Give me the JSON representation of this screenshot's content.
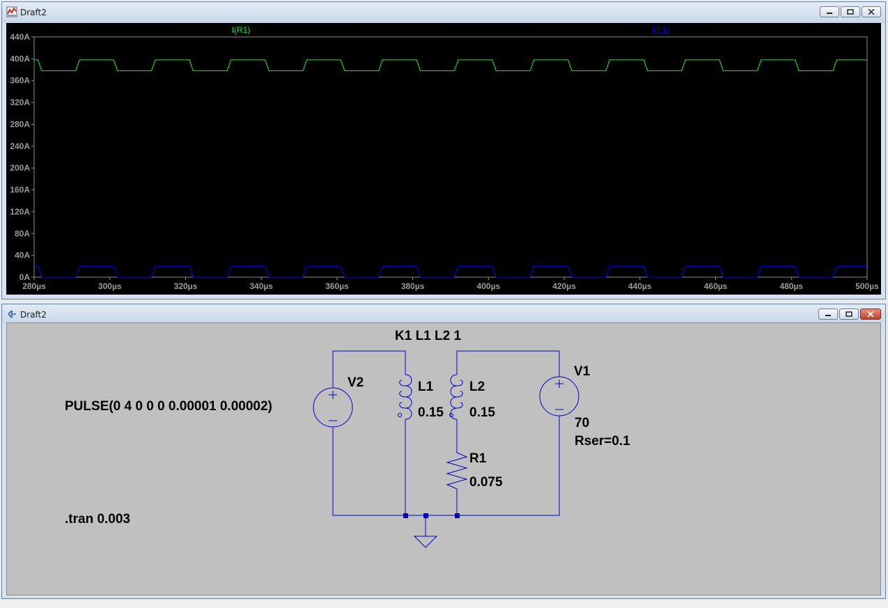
{
  "plot_window": {
    "title": "Draft2",
    "traces": [
      {
        "name": "I(R1)",
        "color": "#00ff00"
      },
      {
        "name": "I(L1)",
        "color": "#0000ff"
      }
    ],
    "y_ticks": [
      "440A",
      "400A",
      "360A",
      "320A",
      "280A",
      "240A",
      "200A",
      "160A",
      "120A",
      "80A",
      "40A",
      "0A"
    ],
    "x_ticks": [
      "280µs",
      "300µs",
      "320µs",
      "340µs",
      "360µs",
      "380µs",
      "400µs",
      "420µs",
      "440µs",
      "460µs",
      "480µs",
      "500µs"
    ]
  },
  "schematic_window": {
    "title": "Draft2",
    "directives": {
      "coupling": "K1 L1 L2 1",
      "tran": ".tran 0.003"
    },
    "components": {
      "v2": {
        "name": "V2",
        "value": "PULSE(0 4 0 0 0 0.00001 0.00002)"
      },
      "l1": {
        "name": "L1",
        "value": "0.15"
      },
      "l2": {
        "name": "L2",
        "value": "0.15"
      },
      "r1": {
        "name": "R1",
        "value": "0.075"
      },
      "v1": {
        "name": "V1",
        "value": "70",
        "param": "Rser=0.1"
      }
    }
  },
  "colors": {
    "plot_bg": "#000000",
    "wire": "#0000cc",
    "schematic_bg": "#c0c0c0"
  }
}
